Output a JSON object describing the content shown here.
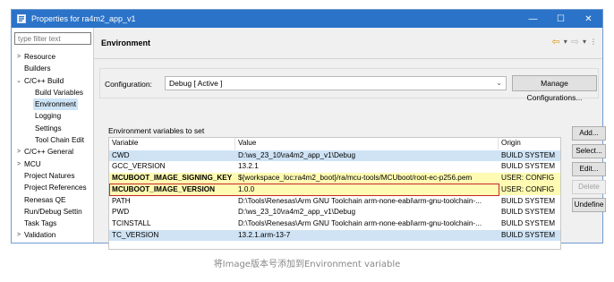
{
  "window": {
    "title": "Properties for ra4m2_app_v1",
    "controls": [
      "—",
      "☐",
      "✕"
    ]
  },
  "filter": {
    "placeholder": "type filter text"
  },
  "tree": [
    {
      "label": "Resource",
      "arrow": ">",
      "indent": 0
    },
    {
      "label": "Builders",
      "arrow": "",
      "indent": 0
    },
    {
      "label": "C/C++ Build",
      "arrow": "⌄",
      "indent": 0
    },
    {
      "label": "Build Variables",
      "arrow": "",
      "indent": 1
    },
    {
      "label": "Environment",
      "arrow": "",
      "indent": 1,
      "selected": true
    },
    {
      "label": "Logging",
      "arrow": "",
      "indent": 1
    },
    {
      "label": "Settings",
      "arrow": "",
      "indent": 1
    },
    {
      "label": "Tool Chain Edit",
      "arrow": "",
      "indent": 1
    },
    {
      "label": "C/C++ General",
      "arrow": ">",
      "indent": 0
    },
    {
      "label": "MCU",
      "arrow": ">",
      "indent": 0
    },
    {
      "label": "Project Natures",
      "arrow": "",
      "indent": 0
    },
    {
      "label": "Project References",
      "arrow": "",
      "indent": 0
    },
    {
      "label": "Renesas QE",
      "arrow": "",
      "indent": 0
    },
    {
      "label": "Run/Debug Settin",
      "arrow": "",
      "indent": 0
    },
    {
      "label": "Task Tags",
      "arrow": "",
      "indent": 0
    },
    {
      "label": "Validation",
      "arrow": ">",
      "indent": 0
    }
  ],
  "page": {
    "heading": "Environment",
    "config_label": "Configuration:",
    "config_value": "Debug  [ Active ]",
    "manage_button": "Manage Configurations...",
    "env_label": "Environment variables to set"
  },
  "table": {
    "headers": [
      "Variable",
      "Value",
      "Origin"
    ],
    "rows": [
      {
        "variable": "CWD",
        "value": "D:\\ws_23_10\\ra4m2_app_v1\\Debug",
        "origin": "BUILD SYSTEM",
        "style": "hl-blue"
      },
      {
        "variable": "GCC_VERSION",
        "value": "13.2.1",
        "origin": "BUILD SYSTEM",
        "style": ""
      },
      {
        "variable": "MCUBOOT_IMAGE_SIGNING_KEY",
        "value": "${workspace_loc:ra4m2_boot}/ra/mcu-tools/MCUboot/root-ec-p256.pem",
        "origin": "USER: CONFIG",
        "style": "hl-yellow"
      },
      {
        "variable": "MCUBOOT_IMAGE_VERSION",
        "value": "1.0.0",
        "origin": "USER: CONFIG",
        "style": "hl-boxed"
      },
      {
        "variable": "PATH",
        "value": "D:\\Tools\\Renesas\\Arm GNU Toolchain arm-none-eabi\\arm-gnu-toolchain-...",
        "origin": "BUILD SYSTEM",
        "style": ""
      },
      {
        "variable": "PWD",
        "value": "D:\\ws_23_10\\ra4m2_app_v1\\Debug",
        "origin": "BUILD SYSTEM",
        "style": ""
      },
      {
        "variable": "TCINSTALL",
        "value": "D:\\Tools\\Renesas\\Arm GNU Toolchain arm-none-eabi\\arm-gnu-toolchain-...",
        "origin": "BUILD SYSTEM",
        "style": ""
      },
      {
        "variable": "TC_VERSION",
        "value": "13.2.1.arm-13-7",
        "origin": "BUILD SYSTEM",
        "style": "hl-blue"
      }
    ]
  },
  "buttons": {
    "add": "Add...",
    "select": "Select...",
    "edit": "Edit...",
    "delete": "Delete",
    "undefine": "Undefine"
  },
  "caption": "将Image版本号添加到Environment variable",
  "colors": {
    "titlebar": "#2b73c8",
    "highlight_yellow": "#fffbb2",
    "highlight_blue": "#cfe3f5",
    "red_box": "#c62828"
  }
}
